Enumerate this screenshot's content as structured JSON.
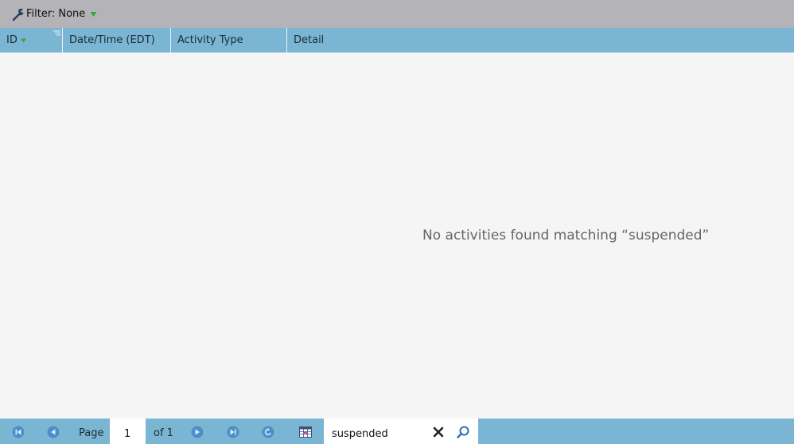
{
  "filter": {
    "label": "Filter:",
    "value": "None",
    "icon": "wrench-icon",
    "caret_color": "#3aa63a"
  },
  "columns": [
    {
      "label": "ID",
      "sorted": "descending"
    },
    {
      "label": "Date/Time (EDT)"
    },
    {
      "label": "Activity Type"
    },
    {
      "label": "Detail"
    }
  ],
  "empty_message": "No activities found matching “suspended”",
  "pager": {
    "page_label": "Page",
    "page_value": "1",
    "of_label": "of 1",
    "search_value": "suspended"
  },
  "colors": {
    "header_bg": "#7ab6d4",
    "filter_bar_bg": "#b3b3b8",
    "body_bg": "#f5f5f5",
    "pager_button": "#4a90c8"
  }
}
